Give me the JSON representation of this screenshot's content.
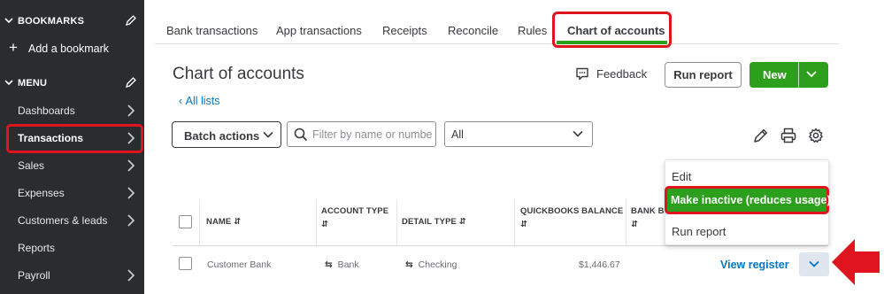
{
  "sidebar": {
    "bookmarks_header": "BOOKMARKS",
    "add_bookmark": "Add a bookmark",
    "menu_header": "MENU",
    "items": [
      {
        "label": "Dashboards"
      },
      {
        "label": "Transactions"
      },
      {
        "label": "Sales"
      },
      {
        "label": "Expenses"
      },
      {
        "label": "Customers & leads"
      },
      {
        "label": "Reports"
      },
      {
        "label": "Payroll"
      }
    ],
    "active_item": "Transactions"
  },
  "tabs": [
    {
      "label": "Bank transactions"
    },
    {
      "label": "App transactions"
    },
    {
      "label": "Receipts"
    },
    {
      "label": "Reconcile"
    },
    {
      "label": "Rules"
    },
    {
      "label": "Chart of accounts"
    }
  ],
  "active_tab": "Chart of accounts",
  "header": {
    "title": "Chart of accounts",
    "all_lists": "All lists",
    "feedback": "Feedback",
    "run_report": "Run report",
    "new_button": "New"
  },
  "filters": {
    "batch_actions": "Batch actions",
    "search_placeholder": "Filter by name or number",
    "type_select": "All"
  },
  "table": {
    "columns": [
      "NAME",
      "ACCOUNT TYPE",
      "DETAIL TYPE",
      "QUICKBOOKS BALANCE",
      "BANK BA"
    ],
    "rows": [
      {
        "name": "Customer Bank",
        "account_type": "Bank",
        "detail_type": "Checking",
        "quickbooks_balance": "$1,446.67",
        "action": "View register"
      }
    ]
  },
  "row_menu": {
    "items": [
      {
        "label": "Edit"
      },
      {
        "label": "Make inactive (reduces usage)"
      },
      {
        "label": "Run report"
      }
    ],
    "highlighted": "Make inactive (reduces usage)"
  },
  "colors": {
    "sidebar_bg": "#2b2c2f",
    "brand_green": "#2ca01c",
    "link_blue": "#0077c5",
    "highlight_red": "#e0141e"
  }
}
